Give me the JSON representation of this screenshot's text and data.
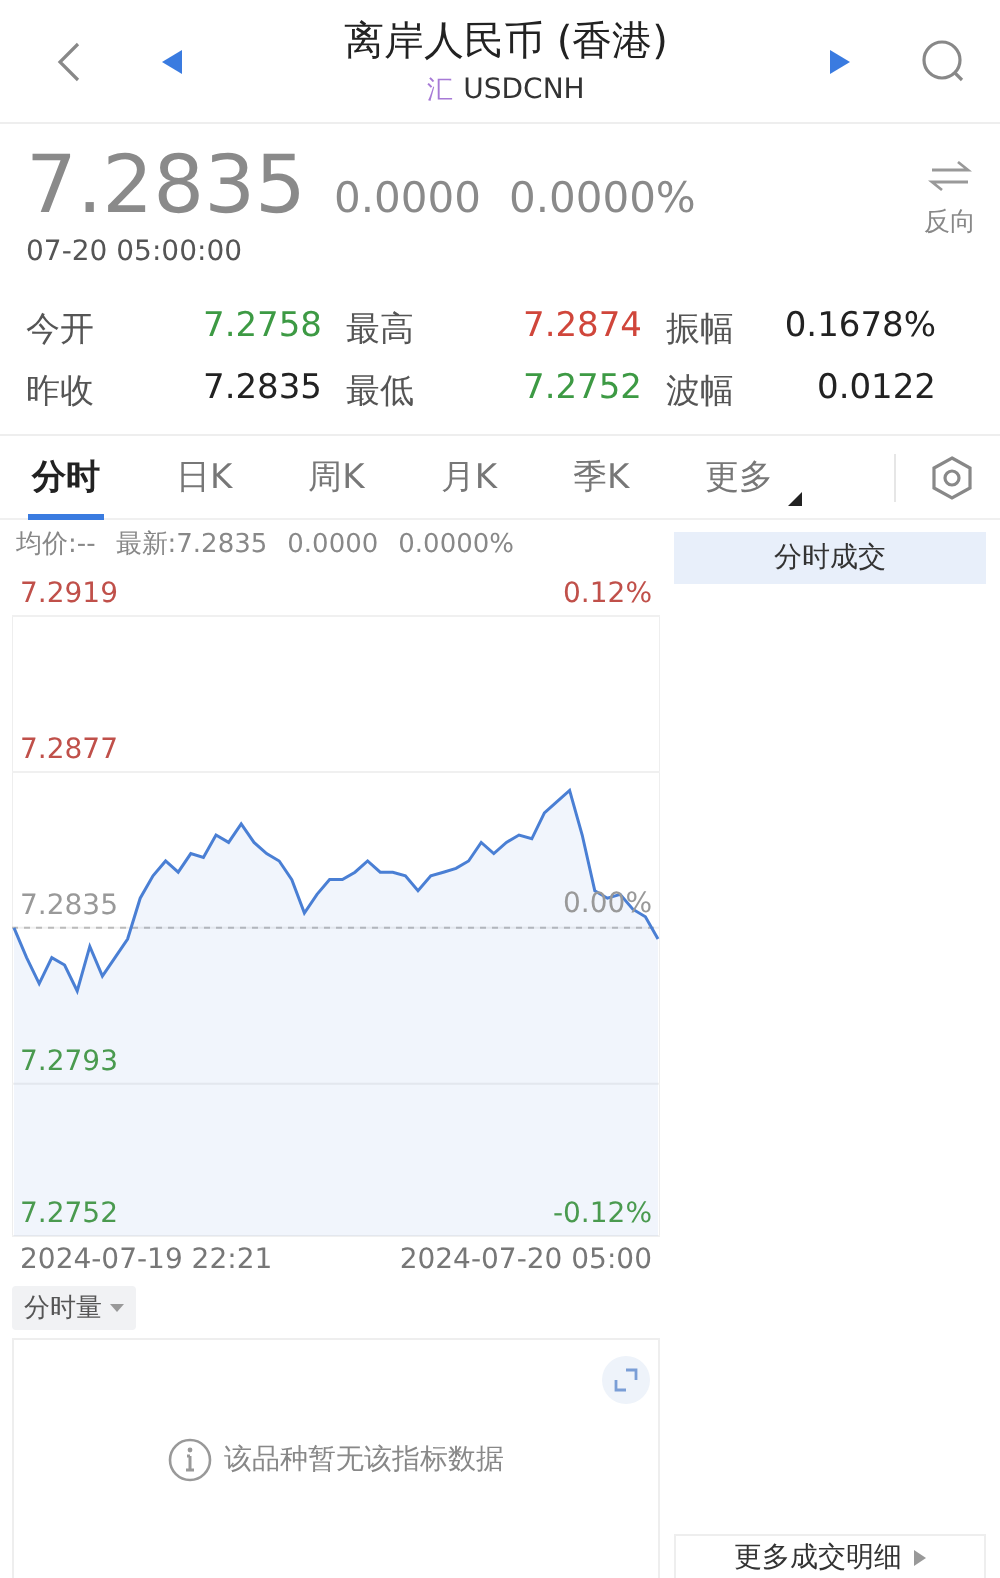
{
  "header": {
    "title": "离岸人民币 (香港)",
    "badge": "汇",
    "symbol": "USDCNH"
  },
  "quote": {
    "price": "7.2835",
    "change": "0.0000",
    "change_pct": "0.0000%",
    "time": "07-20 05:00:00",
    "reverse_label": "反向"
  },
  "stats": [
    {
      "label": "今开",
      "value": "7.2758",
      "color": "#3d9a44"
    },
    {
      "label": "最高",
      "value": "7.2874",
      "color": "#d0463b"
    },
    {
      "label": "振幅",
      "value": "0.1678%",
      "color": "#222222"
    },
    {
      "label": "昨收",
      "value": "7.2835",
      "color": "#222222"
    },
    {
      "label": "最低",
      "value": "7.2752",
      "color": "#3d9a44"
    },
    {
      "label": "波幅",
      "value": "0.0122",
      "color": "#222222"
    }
  ],
  "tabs": [
    {
      "label": "分时",
      "selected": true,
      "kind": "period"
    },
    {
      "label": "日K",
      "selected": false,
      "kind": "period"
    },
    {
      "label": "周K",
      "selected": false,
      "kind": "period"
    },
    {
      "label": "月K",
      "selected": false,
      "kind": "period"
    },
    {
      "label": "季K",
      "selected": false,
      "kind": "period"
    },
    {
      "label": "更多",
      "selected": false,
      "kind": "menu"
    }
  ],
  "legend": {
    "average": "均价:--",
    "latest": "最新:7.2835",
    "change": "0.0000",
    "change_pct": "0.0000%"
  },
  "chart": {
    "percent_labels": [
      {
        "kind": "top",
        "label": "0.12%"
      },
      {
        "kind": "middle",
        "label": "0.00%"
      },
      {
        "kind": "bottom",
        "label": "-0.12%"
      }
    ],
    "time_start": "2024-07-19 22:21",
    "time_end": "2024-07-20 05:00",
    "chart_data": {
      "type": "area",
      "ylim": [
        7.2752,
        7.2919
      ],
      "grid": true,
      "ref_lines": [
        {
          "axis": "y",
          "value": 7.2835
        }
      ],
      "yticks": [
        {
          "value": 7.2919,
          "label": "7.2919"
        },
        {
          "value": 7.2877,
          "label": "7.2877"
        },
        {
          "value": 7.2835,
          "label": "7.2835"
        },
        {
          "value": 7.2793,
          "label": "7.2793"
        },
        {
          "value": 7.2752,
          "label": "7.2752"
        }
      ],
      "series": [
        {
          "color": "#4a7fd4",
          "values": [
            7.2835,
            7.2827,
            7.282,
            7.2827,
            7.2825,
            7.2818,
            7.283,
            7.2822,
            7.2827,
            7.2832,
            7.2843,
            7.2849,
            7.2853,
            7.285,
            7.2855,
            7.2854,
            7.286,
            7.2858,
            7.2863,
            7.2858,
            7.2855,
            7.2853,
            7.2848,
            7.2839,
            7.2844,
            7.2848,
            7.2848,
            7.285,
            7.2853,
            7.285,
            7.285,
            7.2849,
            7.2845,
            7.2849,
            7.285,
            7.2851,
            7.2853,
            7.2858,
            7.2855,
            7.2858,
            7.286,
            7.2859,
            7.2866,
            7.2869,
            7.2872,
            7.286,
            7.2845,
            7.2843,
            7.2844,
            7.284,
            7.2838,
            7.2832
          ]
        }
      ]
    }
  },
  "trades_panel": {
    "title": "分时成交",
    "more_button": "更多成交明细"
  },
  "volume": {
    "selector": "分时量",
    "message": "该品种暂无该指标数据"
  }
}
